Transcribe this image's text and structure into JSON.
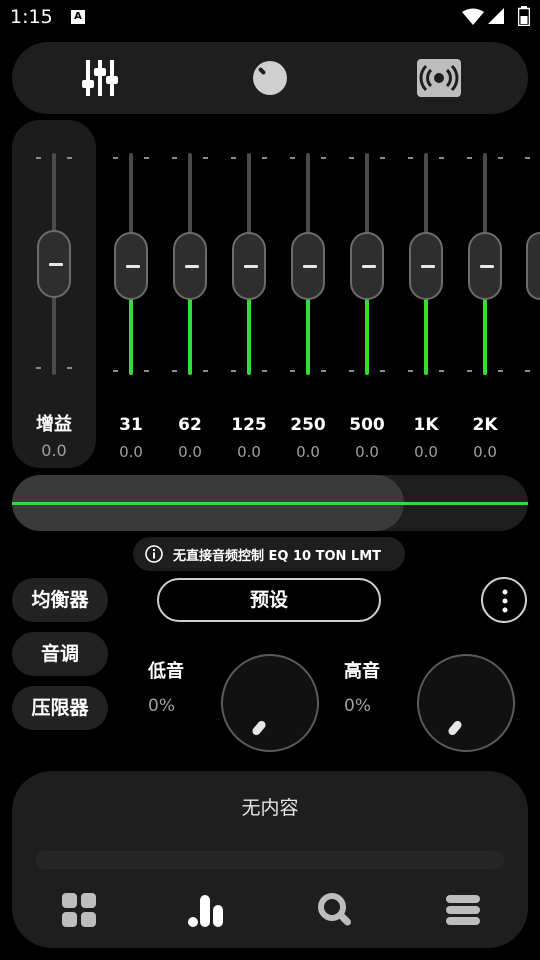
{
  "status_bar": {
    "time": "1:15",
    "notification_letter": "A"
  },
  "top_tabs": [
    {
      "icon": "equalizer-sliders-icon",
      "active": true
    },
    {
      "icon": "knob-icon",
      "active": false
    },
    {
      "icon": "surround-speaker-icon",
      "active": false
    }
  ],
  "gain": {
    "label": "增益",
    "value": "0.0"
  },
  "bands": [
    {
      "freq": "31",
      "value": "0.0"
    },
    {
      "freq": "62",
      "value": "0.0"
    },
    {
      "freq": "125",
      "value": "0.0"
    },
    {
      "freq": "250",
      "value": "0.0"
    },
    {
      "freq": "500",
      "value": "0.0"
    },
    {
      "freq": "1K",
      "value": "0.0"
    },
    {
      "freq": "2K",
      "value": "0.0"
    }
  ],
  "balance": {
    "level": 0.76
  },
  "info": {
    "text": "无直接音频控制 EQ 10 TON LMT",
    "icon": "info-icon"
  },
  "side_buttons": {
    "equalizer": "均衡器",
    "tone": "音调",
    "limiter": "压限器"
  },
  "preset_button": "预设",
  "tone": {
    "bass": {
      "label": "低音",
      "value": "0%"
    },
    "treble": {
      "label": "高音",
      "value": "0%"
    }
  },
  "player": {
    "now_playing": "无内容"
  },
  "bottom_nav": [
    "grid-icon",
    "equalizer-bars-icon",
    "search-icon",
    "menu-icon"
  ],
  "colors": {
    "accent": "#33dd33",
    "background": "#000000",
    "panel": "#1e1e1e"
  }
}
